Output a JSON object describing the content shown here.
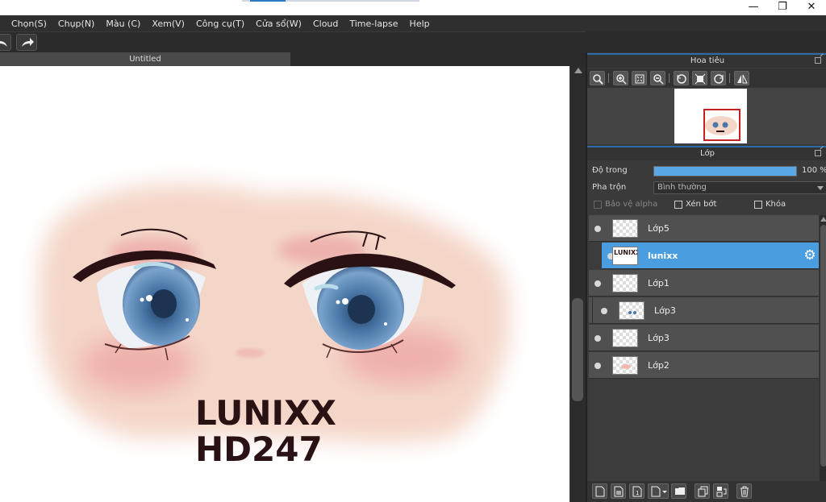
{
  "window": {
    "minimize_glyph": "—",
    "restore_glyph": "❐",
    "close_glyph": "✕"
  },
  "menu": {
    "items": [
      "Chọn(S)",
      "Chụp(N)",
      "Màu (C)",
      "Xem(V)",
      "Công cụ(T)",
      "Cửa sổ(W)",
      "Cloud",
      "Time-lapse",
      "Help"
    ]
  },
  "toolbar": {
    "undo_icon": "undo-icon",
    "redo_icon": "redo-icon"
  },
  "document": {
    "tab_title": "Untitled"
  },
  "artwork": {
    "line1": "LUNIXX",
    "line2": "HD247"
  },
  "navigator": {
    "title": "Hoa tiêu"
  },
  "layers_panel": {
    "title": "Lớp",
    "opacity_label": "Độ trong",
    "opacity_value": "100 %",
    "opacity_percent": 100,
    "blend_label": "Pha trộn",
    "blend_value": "Bình thường",
    "protect_alpha_label": "Bảo vệ alpha",
    "clipping_label": "Xén bớt",
    "lock_label": "Khóa",
    "layers": [
      {
        "name": "Lớp5",
        "selected": false
      },
      {
        "name": "lunixx",
        "selected": true
      },
      {
        "name": "Lớp1",
        "selected": false
      },
      {
        "name": "Lớp3",
        "selected": false
      },
      {
        "name": "Lớp3",
        "selected": false
      },
      {
        "name": "Lớp2",
        "selected": false
      }
    ],
    "selected_thumb_text": "LUNIXX HD247"
  },
  "colors": {
    "accent": "#4a9ee0",
    "panel_bg": "#3a3a3a",
    "nav_frame": "#c92020"
  }
}
